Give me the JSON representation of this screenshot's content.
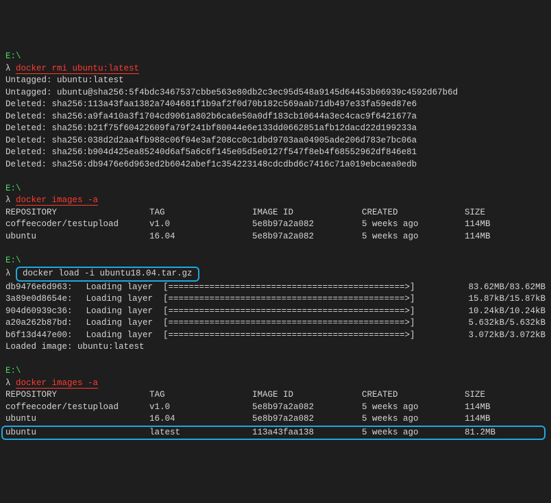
{
  "blocks": [
    {
      "cwd": "E:\\",
      "prompt": "λ ",
      "cmd": "docker rmi ubuntu:latest",
      "cmdStyle": "red",
      "output": [
        "Untagged: ubuntu:latest",
        "Untagged: ubuntu@sha256:5f4bdc3467537cbbe563e80db2c3ec95d548a9145d64453b06939c4592d67b6d",
        "Deleted: sha256:113a43faa1382a7404681f1b9af2f0d70b182c569aab71db497e33fa59ed87e6",
        "Deleted: sha256:a9fa410a3f1704cd9061a802b6ca6e50a0df183cb10644a3ec4cac9f6421677a",
        "Deleted: sha256:b21f75f60422609fa79f241bf80044e6e133dd0662851afb12dacd22d199233a",
        "Deleted: sha256:038d2d2aa4fb988c06f04e3af208cc0c1dbd9703aa04905ade206d783e7bc06a",
        "Deleted: sha256:b904d425ea85240d6af5a6c6f145e05d5e0127f547f8eb4f68552962df846e81",
        "Deleted: sha256:db9476e6d963ed2b6042abef1c354223148cdcdbd6c7416c71a019ebcaea0edb"
      ]
    },
    {
      "cwd": "E:\\",
      "prompt": "λ ",
      "cmd": "docker images -a",
      "cmdStyle": "red",
      "table": {
        "headers": [
          "REPOSITORY",
          "TAG",
          "IMAGE ID",
          "CREATED",
          "SIZE"
        ],
        "rows": [
          [
            "coffeecoder/testupload",
            "v1.0",
            "5e8b97a2a082",
            "5 weeks ago",
            "114MB"
          ],
          [
            "ubuntu",
            "16.04",
            "5e8b97a2a082",
            "5 weeks ago",
            "114MB"
          ]
        ]
      }
    },
    {
      "cwd": "E:\\",
      "prompt": "λ ",
      "cmd": "docker load -i ubuntu18.04.tar.gz",
      "cmdStyle": "blue",
      "layers": [
        {
          "id": "db9476e6d963",
          "txt": "Loading layer",
          "bar": "[==============================================>]",
          "size": "83.62MB/83.62MB"
        },
        {
          "id": "3a89e0d8654e",
          "txt": "Loading layer",
          "bar": "[==============================================>]",
          "size": "15.87kB/15.87kB"
        },
        {
          "id": "904d60939c36",
          "txt": "Loading layer",
          "bar": "[==============================================>]",
          "size": "10.24kB/10.24kB"
        },
        {
          "id": "a20a262b87bd",
          "txt": "Loading layer",
          "bar": "[==============================================>]",
          "size": "5.632kB/5.632kB"
        },
        {
          "id": "b6f13d447e00",
          "txt": "Loading layer",
          "bar": "[==============================================>]",
          "size": "3.072kB/3.072kB"
        }
      ],
      "loaded": "Loaded image: ubuntu:latest"
    },
    {
      "cwd": "E:\\",
      "prompt": "λ ",
      "cmd": "docker images -a",
      "cmdStyle": "red",
      "table": {
        "headers": [
          "REPOSITORY",
          "TAG",
          "IMAGE ID",
          "CREATED",
          "SIZE"
        ],
        "rows": [
          [
            "coffeecoder/testupload",
            "v1.0",
            "5e8b97a2a082",
            "5 weeks ago",
            "114MB"
          ],
          [
            "ubuntu",
            "16.04",
            "5e8b97a2a082",
            "5 weeks ago",
            "114MB"
          ]
        ],
        "highlightRow": [
          "ubuntu",
          "latest",
          "113a43faa138",
          "5 weeks ago",
          "81.2MB"
        ]
      }
    }
  ]
}
